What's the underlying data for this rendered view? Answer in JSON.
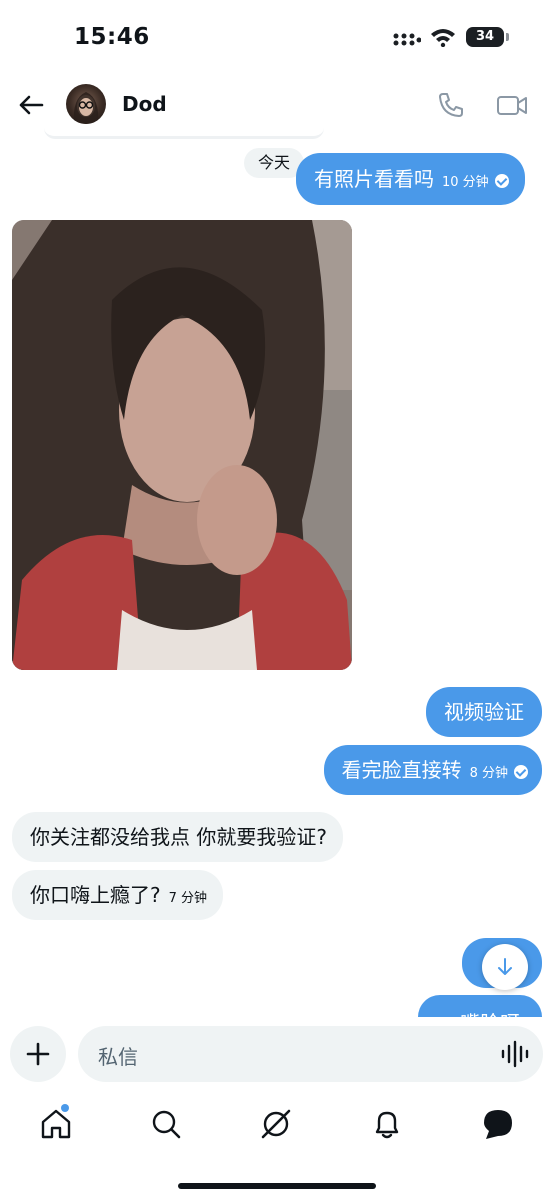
{
  "status_bar": {
    "time": "15:46",
    "battery": "34"
  },
  "header": {
    "contact_name": "Dod"
  },
  "date_separator": "今天",
  "messages": [
    {
      "text": "有照片看看吗",
      "time": "10 分钟",
      "direction": "out",
      "read": true
    },
    {
      "text": "视频验证",
      "direction": "out"
    },
    {
      "text": "看完脸直接转",
      "time": "8 分钟",
      "direction": "out",
      "read": true
    },
    {
      "text": "你关注都没给我点 你就要我验证?",
      "direction": "in"
    },
    {
      "text": "你口嗨上瘾了?",
      "time": "7 分钟",
      "direction": "in"
    },
    {
      "text": "",
      "direction": "out"
    },
    {
      "text": "一嘴脸呀",
      "direction": "out",
      "partially_visible": true
    }
  ],
  "composer": {
    "placeholder": "私信"
  },
  "icons": {
    "back": "back-arrow-icon",
    "call": "phone-icon",
    "video": "video-camera-icon",
    "add": "plus-icon",
    "voice": "voice-wave-icon",
    "scroll": "arrow-down-icon",
    "nav": [
      "home-icon",
      "search-icon",
      "grok-icon",
      "bell-icon",
      "messages-icon"
    ]
  },
  "colors": {
    "outgoing_bubble": "#4a99e9",
    "incoming_bubble": "#eff3f4",
    "text": "#0f1419",
    "secondary_text": "#536471",
    "unread_dot": "#4a99e9"
  }
}
